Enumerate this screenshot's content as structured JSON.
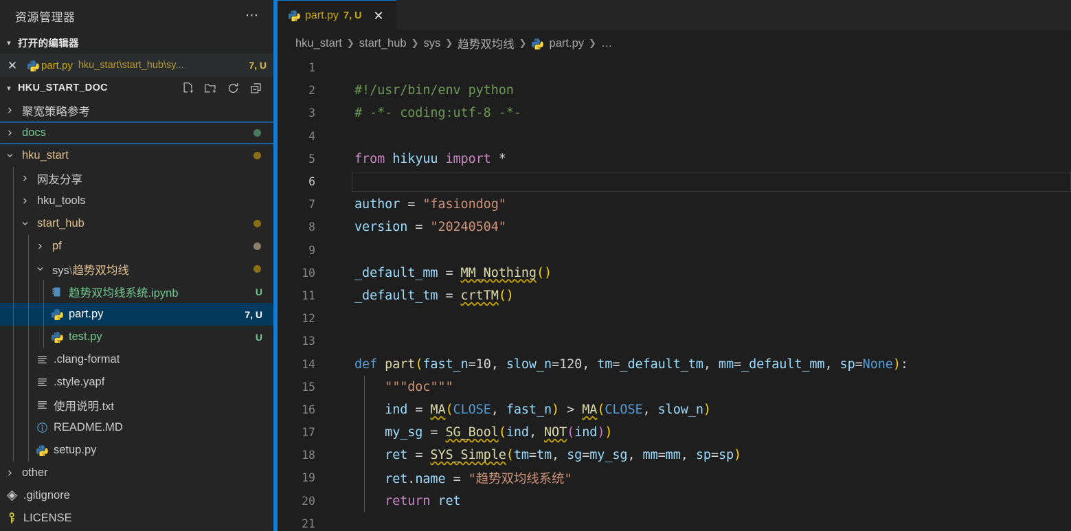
{
  "sidebar": {
    "title": "资源管理器",
    "more_icon": "ellipsis-icon",
    "open_editors": {
      "header": "打开的编辑器",
      "twisty": "chevron-down-icon",
      "items": [
        {
          "close_icon": "close-icon",
          "file_icon": "python-file-icon",
          "name": "part.py",
          "path": "hku_start\\start_hub\\sy...",
          "badge": "7, U"
        }
      ]
    },
    "workspace": {
      "header": "HKU_START_DOC",
      "twisty": "chevron-down-icon",
      "actions": [
        {
          "name": "new-file-icon",
          "title": "新建文件"
        },
        {
          "name": "new-folder-icon",
          "title": "新建文件夹"
        },
        {
          "name": "refresh-icon",
          "title": "刷新"
        },
        {
          "name": "collapse-all-icon",
          "title": "全部折叠"
        }
      ]
    },
    "tree": [
      {
        "label": "聚宽策略参考",
        "type": "folder",
        "twisty": "chevron-right-icon",
        "depth": 0,
        "state": "collapsed",
        "color": "plain",
        "badge": "",
        "dot": ""
      },
      {
        "label": "docs",
        "type": "folder",
        "twisty": "chevron-right-icon",
        "depth": 0,
        "state": "collapsed",
        "color": "new",
        "badge": "",
        "dot": "#4a7a5c",
        "focused": true
      },
      {
        "label": "hku_start",
        "type": "folder",
        "twisty": "chevron-down-icon",
        "depth": 0,
        "state": "expanded",
        "color": "mod",
        "badge": "",
        "dot": "#8a6d12"
      },
      {
        "label": "网友分享",
        "type": "folder",
        "twisty": "chevron-right-icon",
        "depth": 1,
        "state": "collapsed",
        "color": "plain",
        "badge": "",
        "dot": ""
      },
      {
        "label": "hku_tools",
        "type": "folder",
        "twisty": "chevron-right-icon",
        "depth": 1,
        "state": "collapsed",
        "color": "plain",
        "badge": "",
        "dot": ""
      },
      {
        "label": "start_hub",
        "type": "folder",
        "twisty": "chevron-down-icon",
        "depth": 1,
        "state": "expanded",
        "color": "mod",
        "badge": "",
        "dot": "#8a6d12"
      },
      {
        "label": "pf",
        "type": "folder",
        "twisty": "chevron-right-icon",
        "depth": 2,
        "state": "collapsed",
        "color": "mod",
        "badge": "",
        "dot": "#8a7f6a"
      },
      {
        "label": "sys \\ 趋势双均线",
        "type": "folder",
        "twisty": "chevron-down-icon",
        "depth": 2,
        "state": "expanded",
        "color": "mod",
        "badge": "",
        "dot": "#8a6d12"
      },
      {
        "label": "趋势双均线系统.ipynb",
        "type": "notebook",
        "icon": "notebook-file-icon",
        "depth": 3,
        "color": "new",
        "badge": "U",
        "dot": ""
      },
      {
        "label": "part.py",
        "type": "file",
        "icon": "python-file-icon",
        "depth": 3,
        "color": "mod",
        "badge": "7, U",
        "dot": "",
        "selected": true
      },
      {
        "label": "test.py",
        "type": "file",
        "icon": "python-file-icon",
        "depth": 3,
        "color": "new",
        "badge": "U",
        "dot": ""
      },
      {
        "label": ".clang-format",
        "type": "file",
        "icon": "settings-file-icon",
        "depth": 2,
        "color": "plain",
        "badge": "",
        "dot": ""
      },
      {
        "label": ".style.yapf",
        "type": "file",
        "icon": "settings-file-icon",
        "depth": 2,
        "color": "plain",
        "badge": "",
        "dot": ""
      },
      {
        "label": "使用说明.txt",
        "type": "file",
        "icon": "text-file-icon",
        "depth": 2,
        "color": "plain",
        "badge": "",
        "dot": ""
      },
      {
        "label": "README.MD",
        "type": "file",
        "icon": "info-file-icon",
        "depth": 2,
        "color": "plain",
        "badge": "",
        "dot": ""
      },
      {
        "label": "setup.py",
        "type": "file",
        "icon": "python-file-icon",
        "depth": 2,
        "color": "plain",
        "badge": "",
        "dot": ""
      },
      {
        "label": "other",
        "type": "folder",
        "twisty": "chevron-right-icon",
        "depth": 0,
        "state": "collapsed",
        "color": "plain",
        "badge": "",
        "dot": ""
      },
      {
        "label": ".gitignore",
        "type": "file",
        "icon": "git-file-icon",
        "depth": 0,
        "color": "plain",
        "badge": "",
        "dot": ""
      },
      {
        "label": "LICENSE",
        "type": "file",
        "icon": "license-key-icon",
        "depth": 0,
        "color": "plain",
        "badge": "",
        "dot": ""
      }
    ]
  },
  "editor": {
    "tabs": [
      {
        "file_icon": "python-file-icon",
        "name": "part.py",
        "badge": "7, U",
        "close_icon": "close-icon",
        "active": true
      }
    ],
    "breadcrumb": [
      {
        "label": "hku_start",
        "icon": ""
      },
      {
        "label": "start_hub",
        "icon": ""
      },
      {
        "label": "sys",
        "icon": ""
      },
      {
        "label": "趋势双均线",
        "icon": ""
      },
      {
        "label": "part.py",
        "icon": "python-file-icon"
      },
      {
        "label": "…",
        "icon": ""
      }
    ],
    "active_line": 6,
    "lines": [
      {
        "n": 1,
        "tokens": []
      },
      {
        "n": 2,
        "tokens": [
          {
            "t": "#!/usr/bin/env python",
            "c": "cmt"
          }
        ]
      },
      {
        "n": 3,
        "tokens": [
          {
            "t": "# -*- coding:utf-8 -*-",
            "c": "cmt"
          }
        ]
      },
      {
        "n": 4,
        "tokens": []
      },
      {
        "n": 5,
        "tokens": [
          {
            "t": "from",
            "c": "kw"
          },
          {
            "t": " ",
            "c": "plain"
          },
          {
            "t": "hikyuu",
            "c": "var"
          },
          {
            "t": " ",
            "c": "plain"
          },
          {
            "t": "import",
            "c": "kw"
          },
          {
            "t": " ",
            "c": "plain"
          },
          {
            "t": "*",
            "c": "plain"
          }
        ]
      },
      {
        "n": 6,
        "tokens": []
      },
      {
        "n": 7,
        "tokens": [
          {
            "t": "author",
            "c": "var"
          },
          {
            "t": " = ",
            "c": "plain"
          },
          {
            "t": "\"fasiondog\"",
            "c": "str"
          }
        ]
      },
      {
        "n": 8,
        "tokens": [
          {
            "t": "version",
            "c": "var"
          },
          {
            "t": " = ",
            "c": "plain"
          },
          {
            "t": "\"20240504\"",
            "c": "str"
          }
        ]
      },
      {
        "n": 9,
        "tokens": []
      },
      {
        "n": 10,
        "tokens": [
          {
            "t": "_default_mm",
            "c": "var"
          },
          {
            "t": " = ",
            "c": "plain"
          },
          {
            "t": "MM_Nothing",
            "c": "call",
            "squiggly": true
          },
          {
            "t": "(",
            "c": "par"
          },
          {
            "t": ")",
            "c": "par"
          }
        ]
      },
      {
        "n": 11,
        "tokens": [
          {
            "t": "_default_tm",
            "c": "var"
          },
          {
            "t": " = ",
            "c": "plain"
          },
          {
            "t": "crtTM",
            "c": "call",
            "squiggly": true
          },
          {
            "t": "(",
            "c": "par"
          },
          {
            "t": ")",
            "c": "par"
          }
        ]
      },
      {
        "n": 12,
        "tokens": []
      },
      {
        "n": 13,
        "tokens": []
      },
      {
        "n": 14,
        "tokens": [
          {
            "t": "def",
            "c": "kw2"
          },
          {
            "t": " ",
            "c": "plain"
          },
          {
            "t": "part",
            "c": "fn"
          },
          {
            "t": "(",
            "c": "par"
          },
          {
            "t": "fast_n",
            "c": "var"
          },
          {
            "t": "=",
            "c": "plain"
          },
          {
            "t": "10",
            "c": "num"
          },
          {
            "t": ", ",
            "c": "plain"
          },
          {
            "t": "slow_n",
            "c": "var"
          },
          {
            "t": "=",
            "c": "plain"
          },
          {
            "t": "120",
            "c": "num"
          },
          {
            "t": ", ",
            "c": "plain"
          },
          {
            "t": "tm",
            "c": "var"
          },
          {
            "t": "=",
            "c": "plain"
          },
          {
            "t": "_default_tm",
            "c": "var"
          },
          {
            "t": ", ",
            "c": "plain"
          },
          {
            "t": "mm",
            "c": "var"
          },
          {
            "t": "=",
            "c": "plain"
          },
          {
            "t": "_default_mm",
            "c": "var"
          },
          {
            "t": ", ",
            "c": "plain"
          },
          {
            "t": "sp",
            "c": "var"
          },
          {
            "t": "=",
            "c": "plain"
          },
          {
            "t": "None",
            "c": "kw2"
          },
          {
            "t": ")",
            "c": "par"
          },
          {
            "t": ":",
            "c": "plain"
          }
        ]
      },
      {
        "n": 15,
        "tokens": [
          {
            "t": "    ",
            "c": "plain"
          },
          {
            "t": "\"\"\"doc\"\"\"",
            "c": "str"
          }
        ]
      },
      {
        "n": 16,
        "tokens": [
          {
            "t": "    ",
            "c": "plain"
          },
          {
            "t": "ind",
            "c": "var"
          },
          {
            "t": " = ",
            "c": "plain"
          },
          {
            "t": "MA",
            "c": "call",
            "squiggly": true
          },
          {
            "t": "(",
            "c": "par"
          },
          {
            "t": "CLOSE",
            "c": "kw2"
          },
          {
            "t": ", ",
            "c": "plain"
          },
          {
            "t": "fast_n",
            "c": "var"
          },
          {
            "t": ")",
            "c": "par"
          },
          {
            "t": " > ",
            "c": "plain"
          },
          {
            "t": "MA",
            "c": "call",
            "squiggly": true
          },
          {
            "t": "(",
            "c": "par"
          },
          {
            "t": "CLOSE",
            "c": "kw2"
          },
          {
            "t": ", ",
            "c": "plain"
          },
          {
            "t": "slow_n",
            "c": "var"
          },
          {
            "t": ")",
            "c": "par"
          }
        ]
      },
      {
        "n": 17,
        "tokens": [
          {
            "t": "    ",
            "c": "plain"
          },
          {
            "t": "my_sg",
            "c": "var"
          },
          {
            "t": " = ",
            "c": "plain"
          },
          {
            "t": "SG_Bool",
            "c": "call",
            "squiggly": true
          },
          {
            "t": "(",
            "c": "par"
          },
          {
            "t": "ind",
            "c": "var"
          },
          {
            "t": ", ",
            "c": "plain"
          },
          {
            "t": "NOT",
            "c": "call",
            "squiggly": true
          },
          {
            "t": "(",
            "c": "par2"
          },
          {
            "t": "ind",
            "c": "var"
          },
          {
            "t": ")",
            "c": "par2"
          },
          {
            "t": ")",
            "c": "par"
          }
        ]
      },
      {
        "n": 18,
        "tokens": [
          {
            "t": "    ",
            "c": "plain"
          },
          {
            "t": "ret",
            "c": "var"
          },
          {
            "t": " = ",
            "c": "plain"
          },
          {
            "t": "SYS_Simple",
            "c": "call",
            "squiggly": true
          },
          {
            "t": "(",
            "c": "par"
          },
          {
            "t": "tm",
            "c": "var"
          },
          {
            "t": "=",
            "c": "plain"
          },
          {
            "t": "tm",
            "c": "var"
          },
          {
            "t": ", ",
            "c": "plain"
          },
          {
            "t": "sg",
            "c": "var"
          },
          {
            "t": "=",
            "c": "plain"
          },
          {
            "t": "my_sg",
            "c": "var"
          },
          {
            "t": ", ",
            "c": "plain"
          },
          {
            "t": "mm",
            "c": "var"
          },
          {
            "t": "=",
            "c": "plain"
          },
          {
            "t": "mm",
            "c": "var"
          },
          {
            "t": ", ",
            "c": "plain"
          },
          {
            "t": "sp",
            "c": "var"
          },
          {
            "t": "=",
            "c": "plain"
          },
          {
            "t": "sp",
            "c": "var"
          },
          {
            "t": ")",
            "c": "par"
          }
        ]
      },
      {
        "n": 19,
        "tokens": [
          {
            "t": "    ",
            "c": "plain"
          },
          {
            "t": "ret",
            "c": "var"
          },
          {
            "t": ".",
            "c": "plain"
          },
          {
            "t": "name",
            "c": "var"
          },
          {
            "t": " = ",
            "c": "plain"
          },
          {
            "t": "\"趋势双均线系统\"",
            "c": "str"
          }
        ]
      },
      {
        "n": 20,
        "tokens": [
          {
            "t": "    ",
            "c": "plain"
          },
          {
            "t": "return",
            "c": "kw"
          },
          {
            "t": " ",
            "c": "plain"
          },
          {
            "t": "ret",
            "c": "var"
          }
        ]
      },
      {
        "n": 21,
        "tokens": []
      }
    ]
  },
  "colors": {
    "accent": "#0f7bd4",
    "selection": "#04395e",
    "editor_bg": "#1e1e1e",
    "sidebar_bg": "#252526",
    "modified": "#e2c08d",
    "untracked": "#73c991",
    "comment": "#6a9955",
    "string": "#ce9178",
    "variable": "#9cdcfe",
    "keyword": "#c586c0",
    "function": "#dcdcaa",
    "squiggle": "#cca700"
  }
}
